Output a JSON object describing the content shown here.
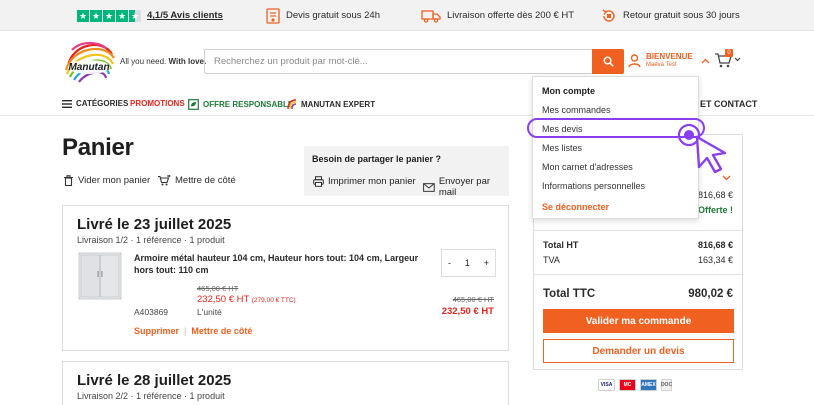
{
  "topbar": {
    "rating": "4,1/5 Avis clients",
    "items": [
      "Devis gratuit sous 24h",
      "Livraison offerte dès 200 € HT",
      "Retour gratuit sous 30 jours"
    ]
  },
  "header": {
    "logo_text": "Manutan",
    "tagline_regular": "All you need.",
    "tagline_bold": "With love.",
    "search_placeholder": "Recherchez un produit par mot-clé...",
    "account_title": "BIENVENUE",
    "account_name": "Maeva Test",
    "cart_count": "0"
  },
  "nav": {
    "categories": "CATÉGORIES",
    "promotions": "PROMOTIONS",
    "responsible": "OFFRE RESPONSABLE",
    "expert": "MANUTAN EXPERT",
    "contact": "ET CONTACT"
  },
  "page": {
    "title": "Panier",
    "empty_cart": "Vider mon panier",
    "save_later": "Mettre de côté"
  },
  "share": {
    "title": "Besoin de partager le panier ?",
    "print": "Imprimer mon panier",
    "email": "Envoyer par mail"
  },
  "deliveries": [
    {
      "title": "Livré le 23 juillet 2025",
      "subtitle": "Livraison 1/2 · 1 référence · 1 produit",
      "product": {
        "name": "Armoire métal hauteur 104 cm, Hauteur hors tout: 104 cm, Largeur hors tout: 110 cm",
        "old_price": "465,00 € HT",
        "price": "232,50 € HT",
        "price_ttc": "(279,00 € TTC)",
        "unit": "L'unité",
        "ref": "A403869",
        "quantity": "1",
        "minus": "-",
        "plus": "+",
        "total_old": "465,00 € HT",
        "total": "232,50 € HT"
      },
      "delete": "Supprimer",
      "separator": "|",
      "save": "Mettre de côté"
    },
    {
      "title": "Livré le 28 juillet 2025",
      "subtitle": "Livraison 2/2 · 1 référence · 1 produit"
    }
  ],
  "summary": {
    "partial_value": "816,68 €",
    "partial_offer": "Offerte !",
    "total_ht_label": "Total HT",
    "total_ht_value": "816,68 €",
    "tva_label": "TVA",
    "tva_value": "163,34 €",
    "ttc_label": "Total TTC",
    "ttc_value": "980,02 €",
    "validate": "Valider ma commande",
    "quote": "Demander un devis"
  },
  "payments": [
    "VISA",
    "MC",
    "AMEX",
    "DOC"
  ],
  "dropdown": {
    "title": "Mon compte",
    "items": [
      "Mes commandes",
      "Mes devis",
      "Mes listes",
      "Mon carnet d'adresses",
      "Informations personnelles"
    ],
    "logout": "Se déconnecter"
  },
  "colors": {
    "brand_orange": "#f06020",
    "price_red": "#e5251c",
    "green": "#1e7a38",
    "highlight_purple": "#8b3ef0",
    "trustpilot_green": "#00b67a"
  }
}
